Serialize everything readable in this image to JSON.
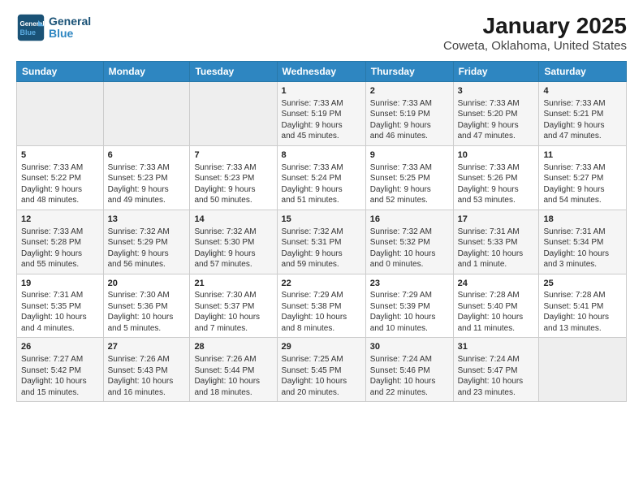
{
  "header": {
    "logo_line1": "General",
    "logo_line2": "Blue",
    "title": "January 2025",
    "subtitle": "Coweta, Oklahoma, United States"
  },
  "days_of_week": [
    "Sunday",
    "Monday",
    "Tuesday",
    "Wednesday",
    "Thursday",
    "Friday",
    "Saturday"
  ],
  "weeks": [
    [
      {
        "num": "",
        "info": ""
      },
      {
        "num": "",
        "info": ""
      },
      {
        "num": "",
        "info": ""
      },
      {
        "num": "1",
        "info": "Sunrise: 7:33 AM\nSunset: 5:19 PM\nDaylight: 9 hours\nand 45 minutes."
      },
      {
        "num": "2",
        "info": "Sunrise: 7:33 AM\nSunset: 5:19 PM\nDaylight: 9 hours\nand 46 minutes."
      },
      {
        "num": "3",
        "info": "Sunrise: 7:33 AM\nSunset: 5:20 PM\nDaylight: 9 hours\nand 47 minutes."
      },
      {
        "num": "4",
        "info": "Sunrise: 7:33 AM\nSunset: 5:21 PM\nDaylight: 9 hours\nand 47 minutes."
      }
    ],
    [
      {
        "num": "5",
        "info": "Sunrise: 7:33 AM\nSunset: 5:22 PM\nDaylight: 9 hours\nand 48 minutes."
      },
      {
        "num": "6",
        "info": "Sunrise: 7:33 AM\nSunset: 5:23 PM\nDaylight: 9 hours\nand 49 minutes."
      },
      {
        "num": "7",
        "info": "Sunrise: 7:33 AM\nSunset: 5:23 PM\nDaylight: 9 hours\nand 50 minutes."
      },
      {
        "num": "8",
        "info": "Sunrise: 7:33 AM\nSunset: 5:24 PM\nDaylight: 9 hours\nand 51 minutes."
      },
      {
        "num": "9",
        "info": "Sunrise: 7:33 AM\nSunset: 5:25 PM\nDaylight: 9 hours\nand 52 minutes."
      },
      {
        "num": "10",
        "info": "Sunrise: 7:33 AM\nSunset: 5:26 PM\nDaylight: 9 hours\nand 53 minutes."
      },
      {
        "num": "11",
        "info": "Sunrise: 7:33 AM\nSunset: 5:27 PM\nDaylight: 9 hours\nand 54 minutes."
      }
    ],
    [
      {
        "num": "12",
        "info": "Sunrise: 7:33 AM\nSunset: 5:28 PM\nDaylight: 9 hours\nand 55 minutes."
      },
      {
        "num": "13",
        "info": "Sunrise: 7:32 AM\nSunset: 5:29 PM\nDaylight: 9 hours\nand 56 minutes."
      },
      {
        "num": "14",
        "info": "Sunrise: 7:32 AM\nSunset: 5:30 PM\nDaylight: 9 hours\nand 57 minutes."
      },
      {
        "num": "15",
        "info": "Sunrise: 7:32 AM\nSunset: 5:31 PM\nDaylight: 9 hours\nand 59 minutes."
      },
      {
        "num": "16",
        "info": "Sunrise: 7:32 AM\nSunset: 5:32 PM\nDaylight: 10 hours\nand 0 minutes."
      },
      {
        "num": "17",
        "info": "Sunrise: 7:31 AM\nSunset: 5:33 PM\nDaylight: 10 hours\nand 1 minute."
      },
      {
        "num": "18",
        "info": "Sunrise: 7:31 AM\nSunset: 5:34 PM\nDaylight: 10 hours\nand 3 minutes."
      }
    ],
    [
      {
        "num": "19",
        "info": "Sunrise: 7:31 AM\nSunset: 5:35 PM\nDaylight: 10 hours\nand 4 minutes."
      },
      {
        "num": "20",
        "info": "Sunrise: 7:30 AM\nSunset: 5:36 PM\nDaylight: 10 hours\nand 5 minutes."
      },
      {
        "num": "21",
        "info": "Sunrise: 7:30 AM\nSunset: 5:37 PM\nDaylight: 10 hours\nand 7 minutes."
      },
      {
        "num": "22",
        "info": "Sunrise: 7:29 AM\nSunset: 5:38 PM\nDaylight: 10 hours\nand 8 minutes."
      },
      {
        "num": "23",
        "info": "Sunrise: 7:29 AM\nSunset: 5:39 PM\nDaylight: 10 hours\nand 10 minutes."
      },
      {
        "num": "24",
        "info": "Sunrise: 7:28 AM\nSunset: 5:40 PM\nDaylight: 10 hours\nand 11 minutes."
      },
      {
        "num": "25",
        "info": "Sunrise: 7:28 AM\nSunset: 5:41 PM\nDaylight: 10 hours\nand 13 minutes."
      }
    ],
    [
      {
        "num": "26",
        "info": "Sunrise: 7:27 AM\nSunset: 5:42 PM\nDaylight: 10 hours\nand 15 minutes."
      },
      {
        "num": "27",
        "info": "Sunrise: 7:26 AM\nSunset: 5:43 PM\nDaylight: 10 hours\nand 16 minutes."
      },
      {
        "num": "28",
        "info": "Sunrise: 7:26 AM\nSunset: 5:44 PM\nDaylight: 10 hours\nand 18 minutes."
      },
      {
        "num": "29",
        "info": "Sunrise: 7:25 AM\nSunset: 5:45 PM\nDaylight: 10 hours\nand 20 minutes."
      },
      {
        "num": "30",
        "info": "Sunrise: 7:24 AM\nSunset: 5:46 PM\nDaylight: 10 hours\nand 22 minutes."
      },
      {
        "num": "31",
        "info": "Sunrise: 7:24 AM\nSunset: 5:47 PM\nDaylight: 10 hours\nand 23 minutes."
      },
      {
        "num": "",
        "info": ""
      }
    ]
  ]
}
